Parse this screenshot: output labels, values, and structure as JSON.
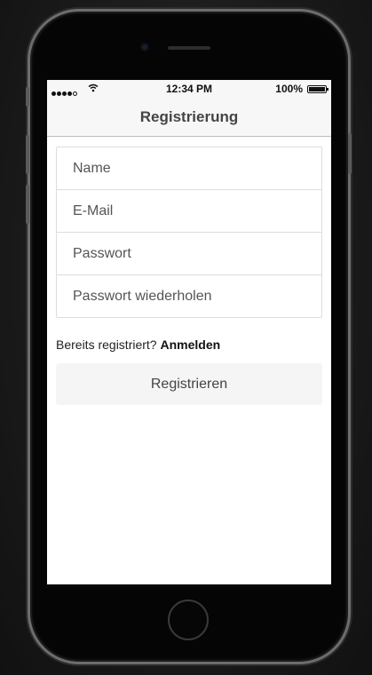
{
  "status_bar": {
    "time": "12:34 PM",
    "battery": "100%",
    "icons": [
      "signal-dots-icon",
      "wifi-icon",
      "battery-icon"
    ]
  },
  "navbar": {
    "title": "Registrierung"
  },
  "form": {
    "fields": [
      {
        "placeholder": "Name",
        "value": ""
      },
      {
        "placeholder": "E-Mail",
        "value": ""
      },
      {
        "placeholder": "Passwort",
        "value": ""
      },
      {
        "placeholder": "Passwort wiederholen",
        "value": ""
      }
    ]
  },
  "login_prompt": {
    "text": "Bereits registriert?",
    "link": "Anmelden"
  },
  "submit": {
    "label": "Registrieren"
  },
  "colors": {
    "bar_background": "#f7f7f7",
    "button_background": "#f5f5f5",
    "border": "#dddddd"
  }
}
